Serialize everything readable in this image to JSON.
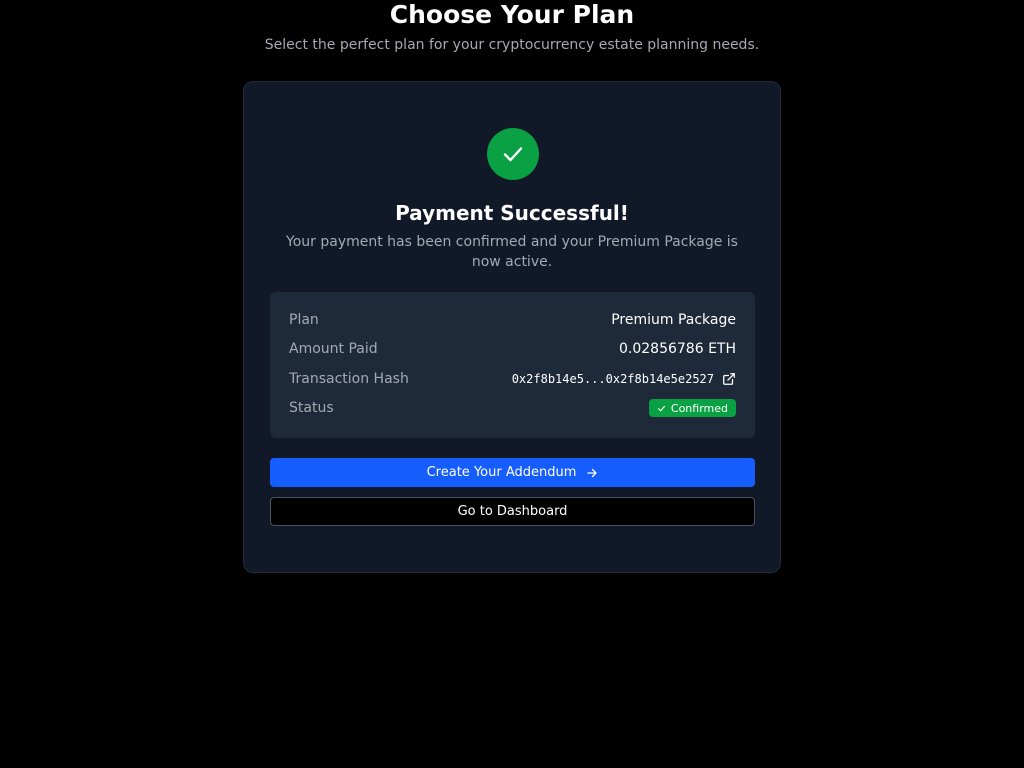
{
  "header": {
    "title": "Choose Your Plan",
    "subtitle": "Select the perfect plan for your cryptocurrency estate planning needs."
  },
  "success": {
    "icon": "check-icon",
    "title": "Payment Successful!",
    "message": "Your payment has been confirmed and your Premium Package is now active."
  },
  "details": {
    "plan": {
      "label": "Plan",
      "value": "Premium Package"
    },
    "amount": {
      "label": "Amount Paid",
      "value": "0.02856786 ETH"
    },
    "hash": {
      "label": "Transaction Hash",
      "value": "0x2f8b14e5...0x2f8b14e5e2527",
      "icon": "external-link-icon"
    },
    "status": {
      "label": "Status",
      "value": "Confirmed",
      "icon": "check-icon"
    }
  },
  "actions": {
    "primary_label": "Create Your Addendum",
    "primary_icon": "arrow-right-icon",
    "secondary_label": "Go to Dashboard"
  },
  "colors": {
    "background": "#000000",
    "card": "#111827",
    "panel": "#1e2939",
    "success": "#0aa144",
    "primary": "#155dfc",
    "muted_text": "#a3aab5"
  }
}
